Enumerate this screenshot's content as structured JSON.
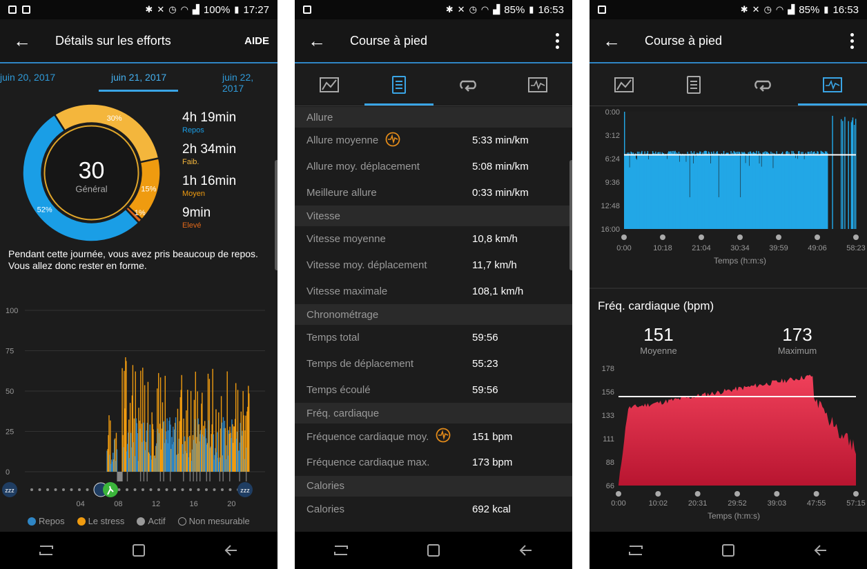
{
  "status": {
    "p1": {
      "battery": "100%",
      "time": "17:27"
    },
    "p2": {
      "battery": "85%",
      "time": "16:53"
    },
    "p3": {
      "battery": "85%",
      "time": "16:53"
    }
  },
  "screen1": {
    "title": "Détails sur les efforts",
    "help": "AIDE",
    "dates": [
      "juin 20, 2017",
      "juin 21, 2017",
      "juin 22, 2017"
    ],
    "score": "30",
    "score_label": "Général",
    "donut": [
      {
        "label": "Repos",
        "pct": 52,
        "text": "52%",
        "color": "#1a9ee6"
      },
      {
        "label": "Faib.",
        "pct": 30,
        "text": "30%",
        "color": "#f4b63c"
      },
      {
        "label": "Moyen",
        "pct": 15,
        "text": "15%",
        "color": "#ef9b10"
      },
      {
        "label": "Elevé",
        "pct": 1,
        "text": "1%",
        "color": "#e0681a"
      }
    ],
    "durations": [
      {
        "time": "4h 19min",
        "label": "Repos",
        "color": "#1a9ee6"
      },
      {
        "time": "2h 34min",
        "label": "Faib.",
        "color": "#f4b63c"
      },
      {
        "time": "1h 16min",
        "label": "Moyen",
        "color": "#ef9b10"
      },
      {
        "time": "9min",
        "label": "Elevé",
        "color": "#e0681a"
      }
    ],
    "summary": "Pendant cette journée, vous avez pris beaucoup de repos. Vous allez donc rester en forme.",
    "legend": [
      {
        "label": "Repos",
        "color": "#2f86c5"
      },
      {
        "label": "Le stress",
        "color": "#ef9b10"
      },
      {
        "label": "Actif",
        "color": "#9a9a9a"
      },
      {
        "label": "Non mesurable",
        "color": "none"
      }
    ],
    "sleep_icon_text": "zzz"
  },
  "screen2": {
    "title": "Course à pied",
    "sections": [
      {
        "name": "Allure",
        "rows": [
          {
            "label": "Allure moyenne",
            "value": "5:33 min/km",
            "icon": "heart-rate-icon"
          },
          {
            "label": "Allure moy. déplacement",
            "value": "5:08 min/km"
          },
          {
            "label": "Meilleure allure",
            "value": "0:33 min/km"
          }
        ]
      },
      {
        "name": "Vitesse",
        "rows": [
          {
            "label": "Vitesse moyenne",
            "value": "10,8 km/h"
          },
          {
            "label": "Vitesse moy. déplacement",
            "value": "11,7 km/h"
          },
          {
            "label": "Vitesse maximale",
            "value": "108,1 km/h"
          }
        ]
      },
      {
        "name": "Chronométrage",
        "rows": [
          {
            "label": "Temps total",
            "value": "59:56"
          },
          {
            "label": "Temps de déplacement",
            "value": "55:23"
          },
          {
            "label": "Temps écoulé",
            "value": "59:56"
          }
        ]
      },
      {
        "name": "Fréq. cardiaque",
        "rows": [
          {
            "label": "Fréquence cardiaque moy.",
            "value": "151 bpm",
            "icon": "heart-rate-icon"
          },
          {
            "label": "Fréquence cardiaque max.",
            "value": "173 bpm"
          }
        ]
      },
      {
        "name": "Calories",
        "rows": [
          {
            "label": "Calories",
            "value": "692 kcal"
          }
        ]
      }
    ]
  },
  "screen3": {
    "title": "Course à pied",
    "hr_title": "Fréq. cardiaque (bpm)",
    "hr_avg": "151",
    "hr_avg_label": "Moyenne",
    "hr_max": "173",
    "hr_max_label": "Maximum"
  },
  "chart_data": [
    {
      "type": "bar",
      "title": "",
      "y_ticks": [
        "100",
        "75",
        "50",
        "25",
        "0"
      ],
      "x_ticks": [
        "04",
        "08",
        "12",
        "16",
        "20"
      ],
      "ylim": [
        0,
        100
      ],
      "x_range": [
        0,
        24
      ],
      "series": [
        {
          "name": "Repos",
          "color": "#2f86c5"
        },
        {
          "name": "Le stress",
          "color": "#ef9b10"
        }
      ]
    },
    {
      "type": "area",
      "title": "",
      "ylabel": "",
      "xlabel": "Temps (h:m:s)",
      "y_ticks": [
        "0:00",
        "3:12",
        "6:24",
        "9:36",
        "12:48",
        "16:00"
      ],
      "x_ticks": [
        "0:00",
        "10:18",
        "21:04",
        "30:34",
        "39:59",
        "49:06",
        "58:23"
      ],
      "ylim_seconds": [
        0,
        960
      ],
      "average_line_seconds": 353,
      "color": "#22a7e6"
    },
    {
      "type": "area",
      "title": "Fréq. cardiaque (bpm)",
      "xlabel": "Temps (h:m:s)",
      "y_ticks": [
        "178",
        "156",
        "133",
        "111",
        "88",
        "66"
      ],
      "x_ticks": [
        "0:00",
        "10:02",
        "20:31",
        "29:52",
        "39:03",
        "47:55",
        "57:15"
      ],
      "ylim": [
        66,
        178
      ],
      "average": 151,
      "max": 173,
      "color": "#e8304f"
    }
  ]
}
